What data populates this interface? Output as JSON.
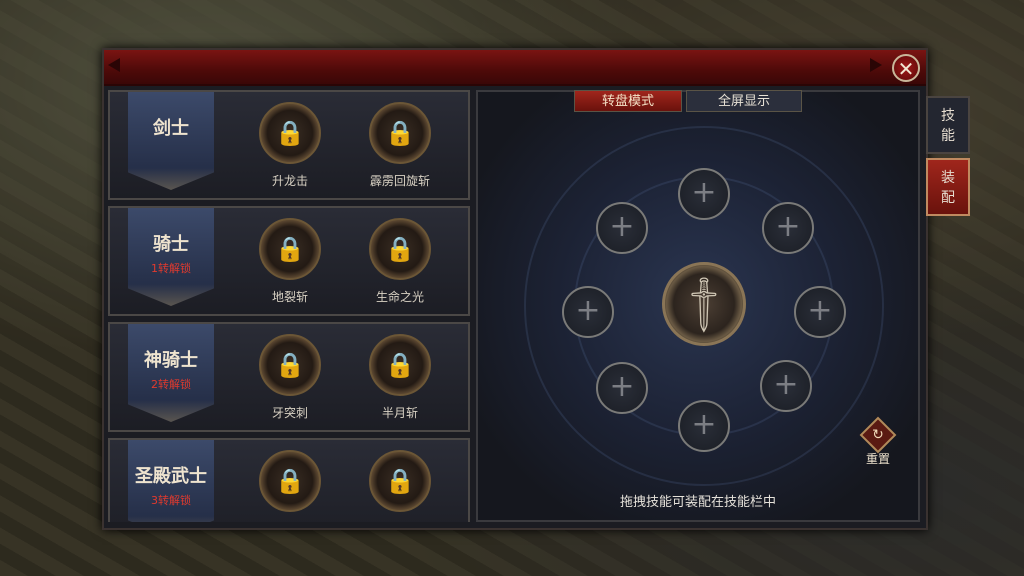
{
  "dialog": {
    "close_glyph": "✕"
  },
  "classes": [
    {
      "name": "剑士",
      "unlock": "",
      "skills": [
        "升龙击",
        "霹雳回旋斩"
      ]
    },
    {
      "name": "骑士",
      "unlock": "1转解锁",
      "skills": [
        "地裂斩",
        "生命之光"
      ]
    },
    {
      "name": "神骑士",
      "unlock": "2转解锁",
      "skills": [
        "牙突刺",
        "半月斩"
      ]
    },
    {
      "name": "圣殿武士",
      "unlock": "3转解锁",
      "skills": [
        "",
        ""
      ]
    }
  ],
  "skill_icon": "lock-icon",
  "mode_tabs": {
    "wheel": "转盘模式",
    "fullscreen": "全屏显示"
  },
  "wheel": {
    "slot_glyph": "+",
    "center_icon": "sword-icon"
  },
  "reset_label": "重置",
  "hint": "拖拽技能可装配在技能栏中",
  "side_tabs": {
    "skills": "技能",
    "equip": "装配"
  },
  "colors": {
    "accent_red": "#a0261c",
    "unlock_red": "#e03a2e",
    "gold_border": "#8a7556"
  }
}
